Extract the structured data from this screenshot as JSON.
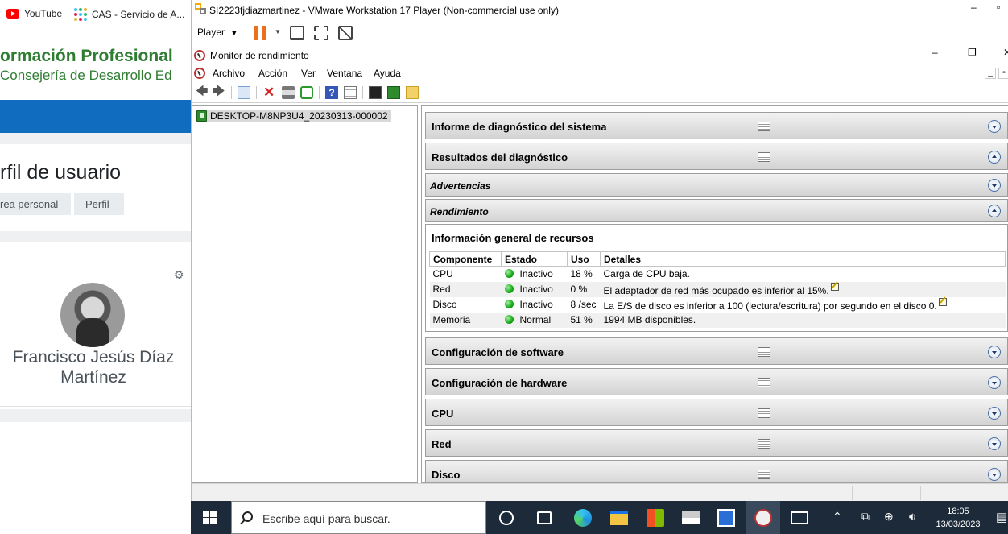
{
  "browser": {
    "bookmarks": [
      {
        "label": "YouTube",
        "icon": "youtube-icon"
      },
      {
        "label": "CAS - Servicio de A...",
        "icon": "slack-icon"
      }
    ],
    "brand_title": "ormación Profesional",
    "brand_subtitle": "Consejería de Desarrollo Ed",
    "page_heading": "rfil de usuario",
    "breadcrumbs": [
      "rea personal",
      "Perfil"
    ],
    "user_name": "Francisco Jesús Díaz Martínez",
    "colors": {
      "brand": "#2e7d32",
      "nav": "#0f6cbf"
    }
  },
  "vmware": {
    "title": "SI2223fjdiazmartinez - VMware Workstation 17 Player (Non-commercial use only)",
    "player_menu": "Player",
    "window_controls": [
      "minimize-icon",
      "maximize-icon"
    ]
  },
  "perfmon": {
    "title": "Monitor de rendimiento",
    "menu": [
      "Archivo",
      "Acción",
      "Ver",
      "Ventana",
      "Ayuda"
    ],
    "tree_item": "DESKTOP-M8NP3U4_20230313-000002",
    "sections": {
      "system_report": "Informe de diagnóstico del sistema",
      "diagnostic_results": "Resultados del diagnóstico",
      "warnings": "Advertencias",
      "performance": "Rendimiento",
      "software": "Configuración de software",
      "hardware": "Configuración de hardware",
      "cpu": "CPU",
      "network": "Red",
      "disk": "Disco"
    },
    "resources": {
      "title": "Información general de recursos",
      "headers": [
        "Componente",
        "Estado",
        "Uso",
        "Detalles"
      ],
      "rows": [
        {
          "component": "CPU",
          "status": "Inactivo",
          "usage": "18 %",
          "details": "Carga de CPU baja.",
          "note": false
        },
        {
          "component": "Red",
          "status": "Inactivo",
          "usage": "0 %",
          "details": "El adaptador de red más ocupado es inferior al 15%.",
          "note": true
        },
        {
          "component": "Disco",
          "status": "Inactivo",
          "usage": "8 /sec",
          "details": "La E/S de disco es inferior a 100 (lectura/escritura) por segundo en el disco 0.",
          "note": true
        },
        {
          "component": "Memoria",
          "status": "Normal",
          "usage": "51 %",
          "details": "1994 MB disponibles.",
          "note": false
        }
      ],
      "status_color": "#17a717"
    }
  },
  "taskbar": {
    "search_placeholder": "Escribe aquí para buscar.",
    "time": "18:05",
    "date": "13/03/2023"
  }
}
